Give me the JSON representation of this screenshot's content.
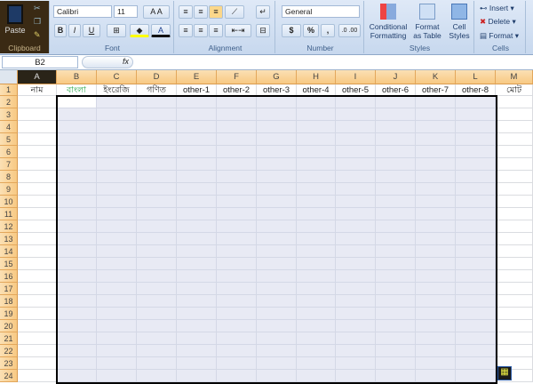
{
  "ribbon": {
    "clipboard": {
      "label": "Clipboard",
      "paste": "Paste"
    },
    "font": {
      "label": "Font",
      "name": "Calibri",
      "size": "11",
      "bold": "B",
      "italic": "I",
      "underline": "U",
      "font_color": "#ff0000",
      "fill_color": "#ffff00"
    },
    "alignment": {
      "label": "Alignment"
    },
    "number": {
      "label": "Number",
      "format": "General",
      "currency": "$",
      "percent": "%",
      "comma": ","
    },
    "styles": {
      "label": "Styles",
      "conditional": "Conditional",
      "conditional2": "Formatting",
      "format_table": "Format",
      "format_table2": "as Table",
      "cell_styles": "Cell",
      "cell_styles2": "Styles"
    },
    "cells": {
      "label": "Cells",
      "insert": "Insert",
      "delete": "Delete",
      "format": "Format"
    }
  },
  "formula_bar": {
    "name_box": "B2",
    "fx": "fx",
    "value": ""
  },
  "columns": [
    "A",
    "B",
    "C",
    "D",
    "E",
    "F",
    "G",
    "H",
    "I",
    "J",
    "K",
    "L",
    "M"
  ],
  "row1": [
    "নাম",
    "বাংলা",
    "ইংরেজি",
    "গণিত",
    "other-1",
    "other-2",
    "other-3",
    "other-4",
    "other-5",
    "other-6",
    "other-7",
    "other-8",
    "মোট"
  ],
  "row_count": 24,
  "selection": "B2:L24",
  "accent": {
    "header": "#f8c983",
    "selection": "#e8eaf4"
  }
}
